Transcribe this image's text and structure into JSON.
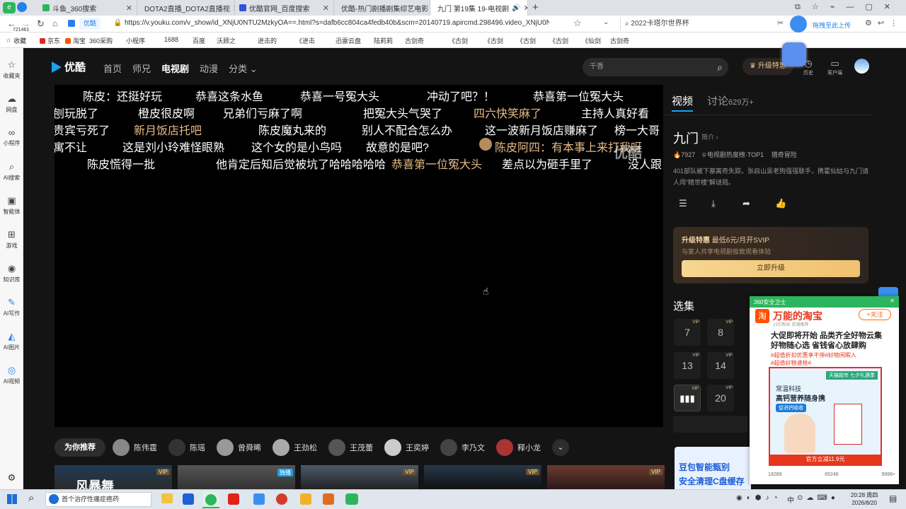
{
  "browser": {
    "tabs": [
      {
        "title": "斗鱼_360搜索"
      },
      {
        "title": "DOTA2直播_DOTA2直播视"
      },
      {
        "title": "优酷官网_百度搜索"
      },
      {
        "title": "优酷-热门剧播剧集综艺电影"
      },
      {
        "title": "九门 第19集 19-电视剧"
      }
    ],
    "new_tab": "+",
    "left_badge": "721461",
    "url": "https://v.youku.com/v_show/id_XNjU0NTU2MzkyOA==.html?s=dafb6cc804ca4fedb40b&scm=20140719.apircmd.298496.video_XNjU0N",
    "search_box": "2022卡塔尔世界杯",
    "upload_label": "拖拽至此上传",
    "bookmarks": [
      "收藏",
      "京东",
      "淘宝",
      "360采购",
      "小程序",
      "1688",
      "百度",
      "沃顾之",
      "进击的",
      "《进击",
      "迅雷云盘",
      "陆莉莉",
      "古剑奇",
      "《古剑",
      "《古剑",
      "《古剑",
      "《古剑",
      "《仙剑",
      "古剑奇"
    ]
  },
  "rail": {
    "items": [
      "收藏夹",
      "网盘",
      "小程序",
      "AI搜索",
      "智能体",
      "游戏",
      "知识库",
      "AI写作",
      "AI图片",
      "AI视频"
    ]
  },
  "site": {
    "logo": "优酷",
    "nav": [
      "首页",
      "师兄",
      "电视剧",
      "动漫",
      "分类"
    ],
    "search_placeholder": "千香",
    "upgrade_label": "升级特惠",
    "icon_labels": [
      "历史",
      "客户端"
    ]
  },
  "danmaku": [
    {
      "t": "陈皮：还挺好玩"
    },
    {
      "t": "恭喜这条水鱼"
    },
    {
      "t": "恭喜一号冤大头"
    },
    {
      "t": "冲动了吧？！"
    },
    {
      "t": "恭喜第一位冤大头"
    },
    {
      "t": "刨玩脱了"
    },
    {
      "t": "橙皮很皮啊"
    },
    {
      "t": "兄弟们亏麻了啊"
    },
    {
      "t": "把冤大头气哭了"
    },
    {
      "t": "四六快笑麻了"
    },
    {
      "t": "主持人真好看"
    },
    {
      "t": "贵宾亏死了"
    },
    {
      "t": "新月饭店托吧"
    },
    {
      "t": "陈皮魔丸来的"
    },
    {
      "t": "别人不配合怎么办"
    },
    {
      "t": "这一波新月饭店赚麻了"
    },
    {
      "t": "榜一大哥"
    },
    {
      "t": "寓不让"
    },
    {
      "t": "这是刘小玲难怪眼熟"
    },
    {
      "t": "这个女的是小鸟吗"
    },
    {
      "t": "故意的是吧?"
    },
    {
      "t": "陈皮阿四：有本事上来打我呀"
    },
    {
      "t": "陈皮慌得一批"
    },
    {
      "t": "他肯定后知后觉被坑了哈哈哈哈哈"
    },
    {
      "t": "恭喜第一位冤大头"
    },
    {
      "t": "差点以为砸手里了"
    },
    {
      "t": "没人跟"
    }
  ],
  "watermark": "优酷",
  "sidebar": {
    "tabs": [
      {
        "label": "视频"
      },
      {
        "label": "讨论",
        "count": "629万+"
      }
    ],
    "show_title": "九门",
    "intro_link": "简介",
    "heat": "7927",
    "rank": "电视剧热度榜·TOP1",
    "genre": "猎奇冒险",
    "description": "401部队被下墓离奇失踪，张启山吴老狗强强联手，携霍仙姑与九门请人闯“精世楼”解谜局。",
    "promo": {
      "title": "升级特惠",
      "price": "最低6元/月开SVIP",
      "sub": "与家人共享电视剧极致观看体验",
      "button": "立即升级"
    },
    "episodes_title": "选集",
    "episodes": [
      {
        "n": "7",
        "vip": "VIP"
      },
      {
        "n": "8",
        "vip": "VIP"
      },
      {
        "n": "13",
        "vip": "VIP"
      },
      {
        "n": "14",
        "vip": "VIP"
      },
      {
        "n": "",
        "vip": "VIP"
      },
      {
        "n": "20",
        "vip": "VIP"
      }
    ]
  },
  "recommend": {
    "label": "为你推荐",
    "people": [
      "陈伟霆",
      "陈瑶",
      "曾舜晞",
      "王劲松",
      "王茂蕾",
      "王奕婷",
      "李乃文",
      "释小龙"
    ],
    "thumbs": [
      {
        "badge": "VIP",
        "title": "风暴舞"
      },
      {
        "badge": "独播"
      },
      {
        "badge": "VIP"
      },
      {
        "badge": "VIP"
      },
      {
        "badge": "VIP"
      }
    ]
  },
  "popup": {
    "header": "360安全卫士",
    "brand": "万能的淘宝",
    "follow": "+关注",
    "fans": "19万粉丝 店铺推荐",
    "headline": "大促即将开始 品类齐全好物云集",
    "headline2": "好物随心选 省钱省心放肆购",
    "tags": "#超值折扣优惠享不停#好物闲暇入",
    "tags2": "#超值好物速抢#",
    "ad_banner": "天猫超市 七夕礼遇季",
    "product_line1": "常温科技",
    "product_line2": "高钙营养随身携",
    "product_badge": "促进钙吸收",
    "price_bar": "官方立减11.9元",
    "stats": [
      "19289",
      "65246",
      "9999+"
    ]
  },
  "corner_ad": {
    "line1": "豆包智能甄别",
    "line2": "安全清理C盘缓存"
  },
  "taskbar": {
    "search_text": "首个治疗性痛症癌药",
    "time": "20:28 周四",
    "date": "2026/8/20",
    "ime": "中"
  }
}
